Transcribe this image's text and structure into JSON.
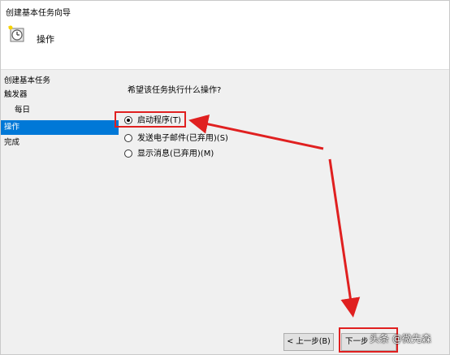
{
  "window": {
    "title": "创建基本任务向导"
  },
  "header": {
    "icon": "task-clock-icon",
    "page_title": "操作"
  },
  "nav": {
    "items": [
      {
        "label": "创建基本任务",
        "selected": false
      },
      {
        "label": "触发器",
        "selected": false
      },
      {
        "label": "每日",
        "selected": false
      },
      {
        "label": "操作",
        "selected": true
      },
      {
        "label": "完成",
        "selected": false
      }
    ]
  },
  "main": {
    "question": "希望该任务执行什么操作?",
    "options": [
      {
        "label": "启动程序(T)",
        "checked": true
      },
      {
        "label": "发送电子邮件(已弃用)(S)",
        "checked": false
      },
      {
        "label": "显示消息(已弃用)(M)",
        "checked": false
      }
    ]
  },
  "buttons": {
    "back": "< 上一步(B)",
    "next": "下一步"
  },
  "watermark": "头条 @微先森",
  "colors": {
    "selection": "#0078d7",
    "annotation": "#e02020"
  }
}
